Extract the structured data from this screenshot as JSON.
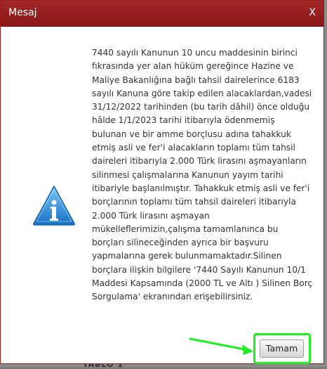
{
  "dialog": {
    "title": "Mesaj",
    "close_label": "X",
    "message": "7440 sayılı Kanunun 10 uncu maddesinin birinci\nfıkrasında yer alan hüküm gereğince Hazine ve\nMaliye Bakanlığına bağlı tahsil dairelerince 6183\nsayılı Kanuna göre takip edilen alacaklardan,vadesi\n31/12/2022 tarihinden (bu tarih dâhil) önce olduğu\nhâlde 1/1/2023 tarihi itibarıyla ödenmemiş\nbulunan ve bir amme borçlusu adına tahakkuk\netmiş asli ve fer'i alacakların toplamı tüm tahsil\ndaireleri itibarıyla 2.000 Türk lirasını aşmayanların\nsilinmesi çalışmalarına Kanunun yayım tarihi\nitibariyle başlanılmıştır. Tahakkuk etmiş asli ve fer'i\nborçlarının toplamı tüm tahsil daireleri itibarıyla\n2.000 Türk lirasını aşmayan\nmükelleflerimizin,çalışma tamamlanınca bu\nborçları silineceğinden ayrıca bir başvuru\nyapmalarına gerek bulunmamaktadır.Silinen\nborçlara ilişkin bilgilere '7440 Sayılı Kanunun 10/1\nMaddesi Kapsamında (2000 TL ve Altı ) Silinen Borç\nSorgulama' ekranından erişebilirsiniz.",
    "ok_label": "Tamam",
    "icon": "info-icon"
  },
  "background": {
    "partial_text": "TABLO 1"
  },
  "colors": {
    "titlebar": "#a22828",
    "highlight": "#22ee22",
    "icon_blue": "#1e88d6"
  }
}
